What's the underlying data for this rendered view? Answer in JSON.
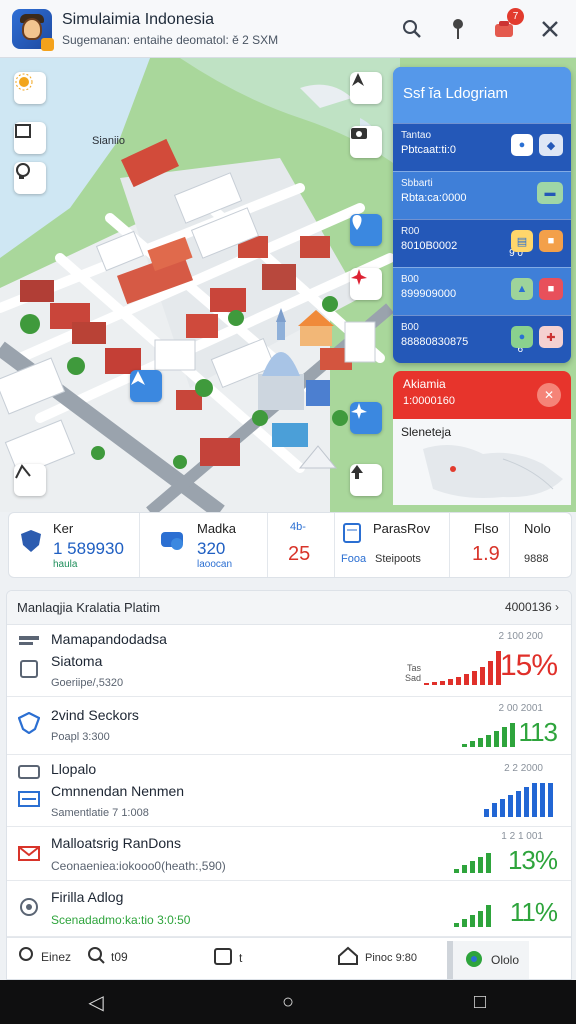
{
  "app": {
    "title": "Simulaimia Indonesia",
    "subtitle": "Sugemanan: entaihe deomatol: ĕ 2 SXM",
    "notification_count": "7"
  },
  "map": {
    "place_label": "Sianiio",
    "colors": {
      "water": "#cfe7f3",
      "land": "#a9d79b",
      "road": "#ffffff"
    }
  },
  "side_panel": {
    "title": "Ssf ĭa Ldogriam",
    "rows": [
      {
        "l1": "Tantao",
        "l2": "Pbtcaat:ti:0"
      },
      {
        "l1": "Sbbarti",
        "l2": "Rbta:ca:0000"
      },
      {
        "l1": "R00",
        "l2": "8010B0002",
        "small": "9 0"
      },
      {
        "l1": "B00",
        "l2": "899909000"
      },
      {
        "l1": "B00",
        "l2": "88880830875",
        "small": "6"
      }
    ]
  },
  "alert": {
    "title": "Akiamia",
    "value": "1:0000160"
  },
  "minimap": {
    "label": "Sleneteja"
  },
  "stats": [
    {
      "label": "Ker",
      "value": "1 589930",
      "sub": "haula"
    },
    {
      "label": "Madka",
      "value": "320",
      "sub": "laoocan"
    },
    {
      "label": "4b-",
      "value": "25"
    },
    {
      "label": "ParasRov",
      "sub_left": "Fooa",
      "sub_right": "Steipoots"
    },
    {
      "label": "Flso",
      "value": "1.9"
    },
    {
      "label": "Nolo",
      "sub": "9888"
    }
  ],
  "list": {
    "title": "Manlaqjia Kralatia Platim",
    "count": "4000136",
    "items": [
      {
        "title": "Mamapandodadsa",
        "title2": "Siatoma",
        "sub": "Goeriipe/,5320",
        "stamp": "2 100 200",
        "pct": "15%",
        "pct_value": 15,
        "note1": "Tas",
        "note2": "Sad",
        "color": "#e0302a"
      },
      {
        "title": "2vind Seckors",
        "sub": "Poapl 3:300",
        "stamp": "2 00 2001",
        "pct": "113",
        "pct_value": 113,
        "color": "#2ea43c"
      },
      {
        "title": "Llopalo",
        "title2": "Cmnnendan Nenmen",
        "sub": "Samentlatie 7 1:008",
        "stamp": "2 2 2000",
        "pct": "",
        "color": "#2266d4"
      },
      {
        "title": "Malloatsrig RanDons",
        "sub": "Ceonaeniea:iokooo0(heath:,590)",
        "stamp": "1 2 1 001",
        "pct": "13%",
        "pct_value": 13,
        "color": "#2ea43c"
      },
      {
        "title": "Firilla Adlog",
        "sub": "Scenadadmo:ka:tio 3:0:50",
        "stamp": "",
        "pct": "11%",
        "pct_value": 11,
        "color": "#2ea43c"
      }
    ]
  },
  "bottom_tabs": [
    {
      "label": "Einez"
    },
    {
      "label": "t09"
    },
    {
      "label": "t"
    },
    {
      "label": "Pinoc 9:80"
    },
    {
      "label": "Ololo"
    }
  ],
  "navbar": {
    "back": "◁",
    "home": "○",
    "recent": "□"
  }
}
